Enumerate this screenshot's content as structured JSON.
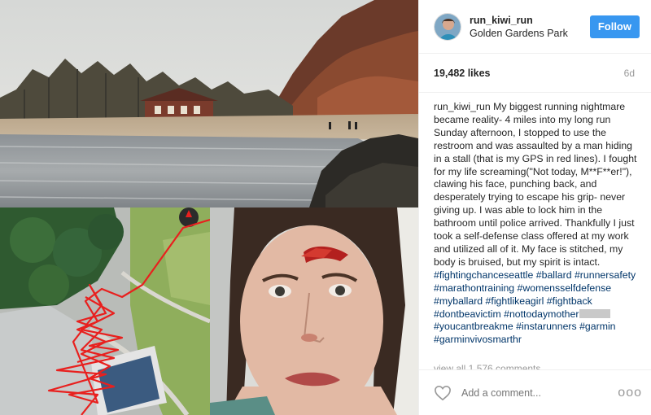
{
  "post": {
    "username": "run_kiwi_run",
    "location": "Golden Gardens Park",
    "follow_label": "Follow",
    "likes": "19,482 likes",
    "age": "6d"
  },
  "caption": {
    "username": "run_kiwi_run",
    "text": "My biggest running nightmare became reality- 4 miles into my long run Sunday afternoon, I stopped to use the restroom and was assaulted by a man hiding in a stall (that is my GPS in red lines). I fought for my life screaming(\"Not today, M**F**er!\"), clawing his face, punching back, and desperately trying to escape his grip- never giving up. I was able to lock him in the bathroom until police arrived. Thankfully I just took a self-defense class offered at my work and utilized all of it. My face is stitched, my body is bruised, but my spirit is intact.",
    "hashtags_before_redaction": "#fightingchanceseattle #ballard #runnersafety #marathontraining #womensselfdefense #myballard #fightlikeagirl #fightback #dontbeavictim #nottodaymother",
    "hashtags_after_redaction": "#youcantbreakme #instarunners #garmin #garminvivosmarthr"
  },
  "comments": {
    "view_all": "view all 1,576 comments",
    "add_placeholder": "Add a comment...",
    "more_label": "ooo"
  },
  "icons": {
    "heart": "heart-outline-icon",
    "more": "more-options-icon",
    "compass": "compass-icon"
  },
  "colors": {
    "follow_button": "#3897f0",
    "hashtag": "#003569",
    "gps_track": "#e8201e"
  }
}
